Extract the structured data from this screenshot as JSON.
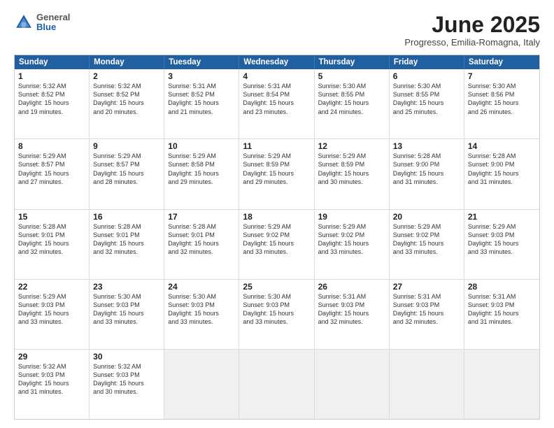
{
  "header": {
    "logo": {
      "general": "General",
      "blue": "Blue"
    },
    "title": "June 2025",
    "subtitle": "Progresso, Emilia-Romagna, Italy"
  },
  "calendar": {
    "weekdays": [
      "Sunday",
      "Monday",
      "Tuesday",
      "Wednesday",
      "Thursday",
      "Friday",
      "Saturday"
    ],
    "rows": [
      [
        {
          "day": "",
          "empty": true
        },
        {
          "day": "2",
          "lines": [
            "Sunrise: 5:32 AM",
            "Sunset: 8:52 PM",
            "Daylight: 15 hours",
            "and 20 minutes."
          ]
        },
        {
          "day": "3",
          "lines": [
            "Sunrise: 5:31 AM",
            "Sunset: 8:52 PM",
            "Daylight: 15 hours",
            "and 21 minutes."
          ]
        },
        {
          "day": "4",
          "lines": [
            "Sunrise: 5:31 AM",
            "Sunset: 8:54 PM",
            "Daylight: 15 hours",
            "and 23 minutes."
          ]
        },
        {
          "day": "5",
          "lines": [
            "Sunrise: 5:30 AM",
            "Sunset: 8:55 PM",
            "Daylight: 15 hours",
            "and 24 minutes."
          ]
        },
        {
          "day": "6",
          "lines": [
            "Sunrise: 5:30 AM",
            "Sunset: 8:55 PM",
            "Daylight: 15 hours",
            "and 25 minutes."
          ]
        },
        {
          "day": "7",
          "lines": [
            "Sunrise: 5:30 AM",
            "Sunset: 8:56 PM",
            "Daylight: 15 hours",
            "and 26 minutes."
          ]
        }
      ],
      [
        {
          "day": "1",
          "lines": [
            "Sunrise: 5:32 AM",
            "Sunset: 8:52 PM",
            "Daylight: 15 hours",
            "and 19 minutes."
          ]
        },
        {
          "day": "",
          "empty": true
        },
        {
          "day": "",
          "empty": true
        },
        {
          "day": "",
          "empty": true
        },
        {
          "day": "",
          "empty": true
        },
        {
          "day": "",
          "empty": true
        },
        {
          "day": "",
          "empty": true
        }
      ],
      [
        {
          "day": "8",
          "lines": [
            "Sunrise: 5:29 AM",
            "Sunset: 8:57 PM",
            "Daylight: 15 hours",
            "and 27 minutes."
          ]
        },
        {
          "day": "9",
          "lines": [
            "Sunrise: 5:29 AM",
            "Sunset: 8:57 PM",
            "Daylight: 15 hours",
            "and 28 minutes."
          ]
        },
        {
          "day": "10",
          "lines": [
            "Sunrise: 5:29 AM",
            "Sunset: 8:58 PM",
            "Daylight: 15 hours",
            "and 29 minutes."
          ]
        },
        {
          "day": "11",
          "lines": [
            "Sunrise: 5:29 AM",
            "Sunset: 8:59 PM",
            "Daylight: 15 hours",
            "and 29 minutes."
          ]
        },
        {
          "day": "12",
          "lines": [
            "Sunrise: 5:29 AM",
            "Sunset: 8:59 PM",
            "Daylight: 15 hours",
            "and 30 minutes."
          ]
        },
        {
          "day": "13",
          "lines": [
            "Sunrise: 5:28 AM",
            "Sunset: 9:00 PM",
            "Daylight: 15 hours",
            "and 31 minutes."
          ]
        },
        {
          "day": "14",
          "lines": [
            "Sunrise: 5:28 AM",
            "Sunset: 9:00 PM",
            "Daylight: 15 hours",
            "and 31 minutes."
          ]
        }
      ],
      [
        {
          "day": "15",
          "lines": [
            "Sunrise: 5:28 AM",
            "Sunset: 9:01 PM",
            "Daylight: 15 hours",
            "and 32 minutes."
          ]
        },
        {
          "day": "16",
          "lines": [
            "Sunrise: 5:28 AM",
            "Sunset: 9:01 PM",
            "Daylight: 15 hours",
            "and 32 minutes."
          ]
        },
        {
          "day": "17",
          "lines": [
            "Sunrise: 5:28 AM",
            "Sunset: 9:01 PM",
            "Daylight: 15 hours",
            "and 32 minutes."
          ]
        },
        {
          "day": "18",
          "lines": [
            "Sunrise: 5:29 AM",
            "Sunset: 9:02 PM",
            "Daylight: 15 hours",
            "and 33 minutes."
          ]
        },
        {
          "day": "19",
          "lines": [
            "Sunrise: 5:29 AM",
            "Sunset: 9:02 PM",
            "Daylight: 15 hours",
            "and 33 minutes."
          ]
        },
        {
          "day": "20",
          "lines": [
            "Sunrise: 5:29 AM",
            "Sunset: 9:02 PM",
            "Daylight: 15 hours",
            "and 33 minutes."
          ]
        },
        {
          "day": "21",
          "lines": [
            "Sunrise: 5:29 AM",
            "Sunset: 9:03 PM",
            "Daylight: 15 hours",
            "and 33 minutes."
          ]
        }
      ],
      [
        {
          "day": "22",
          "lines": [
            "Sunrise: 5:29 AM",
            "Sunset: 9:03 PM",
            "Daylight: 15 hours",
            "and 33 minutes."
          ]
        },
        {
          "day": "23",
          "lines": [
            "Sunrise: 5:30 AM",
            "Sunset: 9:03 PM",
            "Daylight: 15 hours",
            "and 33 minutes."
          ]
        },
        {
          "day": "24",
          "lines": [
            "Sunrise: 5:30 AM",
            "Sunset: 9:03 PM",
            "Daylight: 15 hours",
            "and 33 minutes."
          ]
        },
        {
          "day": "25",
          "lines": [
            "Sunrise: 5:30 AM",
            "Sunset: 9:03 PM",
            "Daylight: 15 hours",
            "and 33 minutes."
          ]
        },
        {
          "day": "26",
          "lines": [
            "Sunrise: 5:31 AM",
            "Sunset: 9:03 PM",
            "Daylight: 15 hours",
            "and 32 minutes."
          ]
        },
        {
          "day": "27",
          "lines": [
            "Sunrise: 5:31 AM",
            "Sunset: 9:03 PM",
            "Daylight: 15 hours",
            "and 32 minutes."
          ]
        },
        {
          "day": "28",
          "lines": [
            "Sunrise: 5:31 AM",
            "Sunset: 9:03 PM",
            "Daylight: 15 hours",
            "and 31 minutes."
          ]
        }
      ],
      [
        {
          "day": "29",
          "lines": [
            "Sunrise: 5:32 AM",
            "Sunset: 9:03 PM",
            "Daylight: 15 hours",
            "and 31 minutes."
          ]
        },
        {
          "day": "30",
          "lines": [
            "Sunrise: 5:32 AM",
            "Sunset: 9:03 PM",
            "Daylight: 15 hours",
            "and 30 minutes."
          ]
        },
        {
          "day": "",
          "empty": true,
          "lastrow": true
        },
        {
          "day": "",
          "empty": true,
          "lastrow": true
        },
        {
          "day": "",
          "empty": true,
          "lastrow": true
        },
        {
          "day": "",
          "empty": true,
          "lastrow": true
        },
        {
          "day": "",
          "empty": true,
          "lastrow": true
        }
      ]
    ]
  }
}
